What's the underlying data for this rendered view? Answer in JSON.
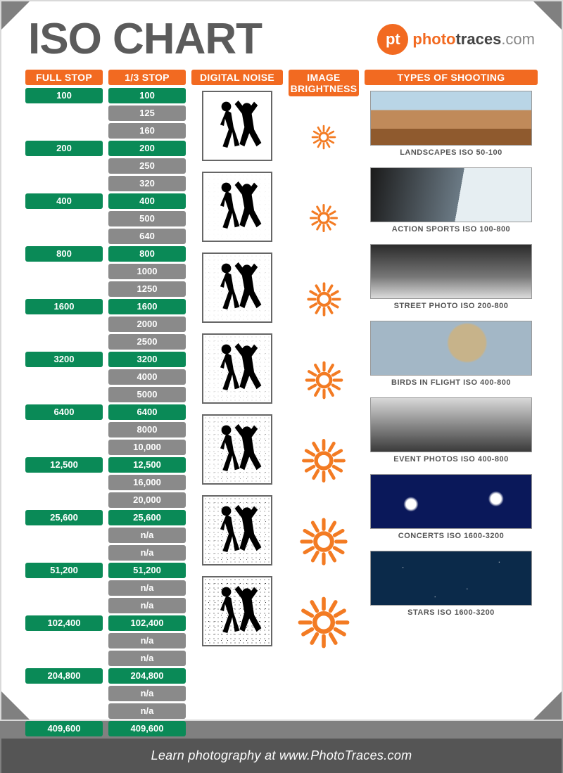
{
  "title": "ISO CHART",
  "brand": {
    "pt": "pt",
    "photo": "photo",
    "traces": "traces",
    "com": ".com"
  },
  "headers": {
    "full": "FULL STOP",
    "third": "1/3 STOP",
    "noise": "DIGITAL NOISE",
    "bright": "IMAGE BRIGHTNESS",
    "types": "TYPES OF SHOOTING"
  },
  "footer": "Learn photography at www.PhotoTraces.com",
  "chart_data": {
    "type": "table",
    "title": "ISO CHART",
    "full_stops": [
      "100",
      "200",
      "400",
      "800",
      "1600",
      "3200",
      "6400",
      "12,500",
      "25,600",
      "51,200",
      "102,400",
      "204,800",
      "409,600"
    ],
    "third_stops": [
      {
        "v": "100",
        "full": true
      },
      {
        "v": "125",
        "full": false
      },
      {
        "v": "160",
        "full": false
      },
      {
        "v": "200",
        "full": true
      },
      {
        "v": "250",
        "full": false
      },
      {
        "v": "320",
        "full": false
      },
      {
        "v": "400",
        "full": true
      },
      {
        "v": "500",
        "full": false
      },
      {
        "v": "640",
        "full": false
      },
      {
        "v": "800",
        "full": true
      },
      {
        "v": "1000",
        "full": false
      },
      {
        "v": "1250",
        "full": false
      },
      {
        "v": "1600",
        "full": true
      },
      {
        "v": "2000",
        "full": false
      },
      {
        "v": "2500",
        "full": false
      },
      {
        "v": "3200",
        "full": true
      },
      {
        "v": "4000",
        "full": false
      },
      {
        "v": "5000",
        "full": false
      },
      {
        "v": "6400",
        "full": true
      },
      {
        "v": "8000",
        "full": false
      },
      {
        "v": "10,000",
        "full": false
      },
      {
        "v": "12,500",
        "full": true
      },
      {
        "v": "16,000",
        "full": false
      },
      {
        "v": "20,000",
        "full": false
      },
      {
        "v": "25,600",
        "full": true
      },
      {
        "v": "n/a",
        "full": false
      },
      {
        "v": "n/a",
        "full": false
      },
      {
        "v": "51,200",
        "full": true
      },
      {
        "v": "n/a",
        "full": false
      },
      {
        "v": "n/a",
        "full": false
      },
      {
        "v": "102,400",
        "full": true
      },
      {
        "v": "n/a",
        "full": false
      },
      {
        "v": "n/a",
        "full": false
      },
      {
        "v": "204,800",
        "full": true
      },
      {
        "v": "n/a",
        "full": false
      },
      {
        "v": "n/a",
        "full": false
      },
      {
        "v": "409,600",
        "full": true
      }
    ],
    "noise_levels": [
      0.0,
      0.05,
      0.12,
      0.22,
      0.4,
      0.6,
      0.85
    ],
    "brightness_levels": [
      0.3,
      0.4,
      0.55,
      0.65,
      0.8,
      0.9,
      1.0
    ],
    "shooting_types": [
      {
        "caption": "LANDSCAPES ISO 50-100",
        "cls": "ph-landscape"
      },
      {
        "caption": "ACTION SPORTS ISO 100-800",
        "cls": "ph-action"
      },
      {
        "caption": "STREET PHOTO ISO 200-800",
        "cls": "ph-street"
      },
      {
        "caption": "BIRDS IN FLIGHT ISO 400-800",
        "cls": "ph-birds"
      },
      {
        "caption": "EVENT PHOTOS ISO 400-800",
        "cls": "ph-event"
      },
      {
        "caption": "CONCERTS ISO 1600-3200",
        "cls": "ph-concert"
      },
      {
        "caption": "STARS  ISO 1600-3200",
        "cls": "ph-stars"
      }
    ]
  }
}
